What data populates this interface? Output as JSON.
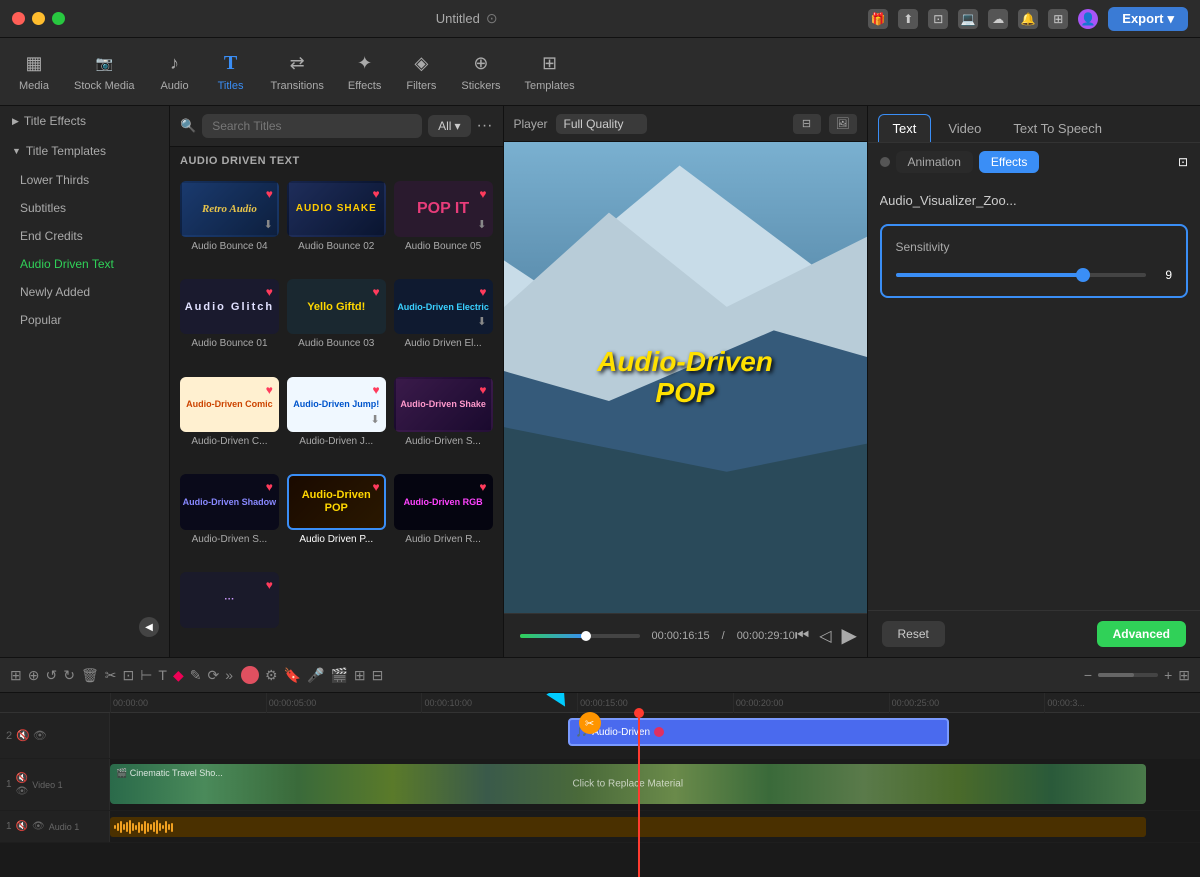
{
  "app": {
    "title": "Untitled",
    "export_label": "Export"
  },
  "toolbar": {
    "items": [
      {
        "id": "media",
        "label": "Media",
        "icon": "▦"
      },
      {
        "id": "stock_media",
        "label": "Stock Media",
        "icon": "🎬"
      },
      {
        "id": "audio",
        "label": "Audio",
        "icon": "♪"
      },
      {
        "id": "titles",
        "label": "Titles",
        "icon": "T",
        "active": true
      },
      {
        "id": "transitions",
        "label": "Transitions",
        "icon": "⇄"
      },
      {
        "id": "effects",
        "label": "Effects",
        "icon": "✦"
      },
      {
        "id": "filters",
        "label": "Filters",
        "icon": "◈"
      },
      {
        "id": "stickers",
        "label": "Stickers",
        "icon": "⊕"
      },
      {
        "id": "templates",
        "label": "Templates",
        "icon": "⊞"
      }
    ]
  },
  "left_panel": {
    "title_effects_header": "Title Effects",
    "title_templates_header": "Title Templates",
    "nav_items": [
      {
        "label": "Lower Thirds",
        "active": false
      },
      {
        "label": "Subtitles",
        "active": false
      },
      {
        "label": "End Credits",
        "active": false
      },
      {
        "label": "Audio Driven Text",
        "active": true
      },
      {
        "label": "Newly Added",
        "active": false
      },
      {
        "label": "Popular",
        "active": false
      }
    ]
  },
  "center_panel": {
    "search_placeholder": "Search Titles",
    "filter_label": "All",
    "section_label": "AUDIO DRIVEN TEXT",
    "grid_items": [
      {
        "label": "Audio Bounce 04",
        "thumb_type": "bounce04",
        "thumb_text": "Retro Audio",
        "heart": true,
        "download": true
      },
      {
        "label": "Audio Bounce 02",
        "thumb_type": "bounce02",
        "thumb_text": "AUDIO SHAKE",
        "heart": true,
        "download": false
      },
      {
        "label": "Audio Bounce 05",
        "thumb_type": "bounce05",
        "thumb_text": "POP IT",
        "heart": true,
        "download": true
      },
      {
        "label": "Audio Bounce 01",
        "thumb_type": "bounce01",
        "thumb_text": "Audio Glitch",
        "heart": true,
        "download": false
      },
      {
        "label": "Audio Bounce 03",
        "thumb_type": "bounce03",
        "thumb_text": "Yello Giftd!",
        "heart": true,
        "download": false
      },
      {
        "label": "Audio Driven El...",
        "thumb_type": "elec",
        "thumb_text": "Audio-Driven Electric",
        "heart": true,
        "download": true
      },
      {
        "label": "Audio-Driven C...",
        "thumb_type": "comic",
        "thumb_text": "Audio-Driven Comic",
        "heart": true,
        "download": false
      },
      {
        "label": "Audio-Driven J...",
        "thumb_type": "jump",
        "thumb_text": "Audio-Driven Jump!",
        "heart": true,
        "download": true
      },
      {
        "label": "Audio-Driven S...",
        "thumb_type": "shake",
        "thumb_text": "Audio-Driven Shake",
        "heart": true,
        "download": false
      },
      {
        "label": "Audio-Driven S...",
        "thumb_type": "shadow",
        "thumb_text": "Audio-Driven Shadow",
        "heart": true,
        "download": false
      },
      {
        "label": "Audio Driven P...",
        "thumb_type": "pop_sel",
        "thumb_text": "Audio-Driven POP",
        "heart": true,
        "download": false,
        "selected": true
      },
      {
        "label": "Audio Driven R...",
        "thumb_type": "rgb",
        "thumb_text": "Audio-Driven RGB",
        "heart": true,
        "download": false
      }
    ],
    "row4_items": [
      {
        "thumb_type": "partial",
        "thumb_text": "...",
        "heart": true
      }
    ]
  },
  "preview": {
    "player_label": "Player",
    "quality_label": "Full Quality",
    "overlay_line1": "Audio-Driven",
    "overlay_line2": "POP",
    "time_current": "00:00:16:15",
    "time_total": "00:00:29:10",
    "progress_percent": 56
  },
  "right_panel": {
    "tabs": [
      {
        "label": "Text",
        "active": true
      },
      {
        "label": "Video",
        "active": false
      },
      {
        "label": "Text To Speech",
        "active": false
      }
    ],
    "sub_tabs": [
      {
        "label": "Animation",
        "active": false
      },
      {
        "label": "Effects",
        "active": true
      }
    ],
    "effect_name": "Audio_Visualizer_Zoo...",
    "sensitivity_label": "Sensitivity",
    "sensitivity_value": "9",
    "reset_label": "Reset",
    "advanced_label": "Advanced"
  },
  "timeline": {
    "tracks": [
      {
        "id": "track2",
        "type": "title",
        "layer": 2,
        "icons": [
          "🔇",
          "👁"
        ],
        "clips": [
          {
            "label": "🎵 Audio-Driven",
            "color": "#4a7aff",
            "left": "42%",
            "width": "34%",
            "border": "#6a9aff"
          }
        ]
      },
      {
        "id": "track1_video",
        "type": "video",
        "layer": 1,
        "label": "Video 1",
        "icons": [
          "🔇",
          "👁"
        ],
        "clips": [
          {
            "label": "Cinematic Travel Sho...",
            "color": "video_gradient",
            "left": "0%",
            "width": "95%"
          }
        ]
      },
      {
        "id": "track1_audio",
        "type": "audio",
        "layer": 1,
        "label": "Audio 1",
        "icons": [
          "🔇",
          "👁"
        ],
        "clips": []
      }
    ],
    "ruler_marks": [
      "00:00:00",
      "00:00:05:00",
      "00:00:10:00",
      "00:00:15:00",
      "00:00:20:00",
      "00:00:25:00",
      "00:00:3..."
    ],
    "playhead_position": "44%"
  }
}
